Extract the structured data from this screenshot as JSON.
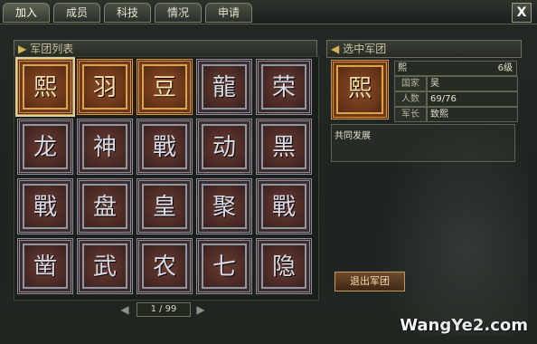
{
  "tabs": [
    "加入",
    "成员",
    "科技",
    "情况",
    "申请"
  ],
  "close_label": "X",
  "left_panel": {
    "title": "军团列表",
    "tiles": [
      {
        "char": "熙",
        "style": "gold"
      },
      {
        "char": "羽",
        "style": "gold"
      },
      {
        "char": "豆",
        "style": "gold"
      },
      {
        "char": "龍",
        "style": "silver"
      },
      {
        "char": "荣",
        "style": "silver"
      },
      {
        "char": "龙",
        "style": "silver"
      },
      {
        "char": "神",
        "style": "silver"
      },
      {
        "char": "戰",
        "style": "silver"
      },
      {
        "char": "动",
        "style": "silver"
      },
      {
        "char": "黑",
        "style": "silver"
      },
      {
        "char": "戰",
        "style": "silver"
      },
      {
        "char": "盘",
        "style": "silver"
      },
      {
        "char": "皇",
        "style": "silver"
      },
      {
        "char": "聚",
        "style": "silver"
      },
      {
        "char": "戰",
        "style": "silver"
      },
      {
        "char": "凿",
        "style": "silver"
      },
      {
        "char": "武",
        "style": "silver"
      },
      {
        "char": "农",
        "style": "silver"
      },
      {
        "char": "七",
        "style": "silver"
      },
      {
        "char": "隐",
        "style": "silver"
      }
    ],
    "pager": {
      "text": "1 / 99",
      "prev": "◀",
      "next": "▶"
    }
  },
  "right_panel": {
    "title": "选中军团",
    "emblem_char": "熙",
    "name": "熙",
    "level": "6级",
    "rows": [
      {
        "label": "国家",
        "value": "吴"
      },
      {
        "label": "人数",
        "value": "69/76"
      },
      {
        "label": "军长",
        "value": "致熙"
      }
    ],
    "motto": "共同发展",
    "quit_button": "退出军团"
  },
  "watermark": "WangYe2.com",
  "colors": {
    "gold_border": "#d8913c",
    "silver_border": "#8a8fa0",
    "panel_bg": "#1d231f"
  }
}
